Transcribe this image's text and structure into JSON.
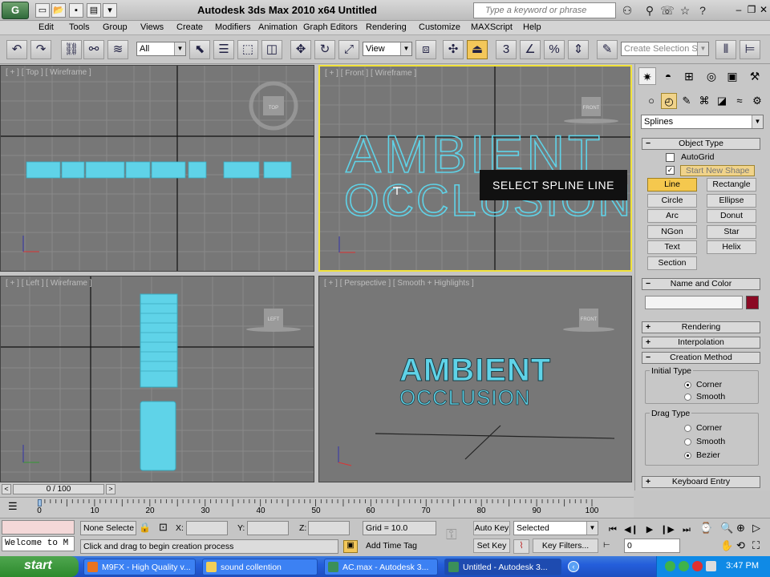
{
  "app": {
    "title": "Autodesk 3ds Max  2010 x64      Untitled",
    "logo": "G",
    "search_placeholder": "Type a keyword or phrase"
  },
  "menu": [
    "Edit",
    "Tools",
    "Group",
    "Views",
    "Create",
    "Modifiers",
    "Animation",
    "Graph Editors",
    "Rendering",
    "Customize",
    "MAXScript",
    "Help"
  ],
  "toolbar": {
    "selection_filter": "All",
    "ref_coord": "View",
    "named_selection_placeholder": "Create Selection Se"
  },
  "viewports": [
    {
      "id": "top",
      "label": "[ + ] [ Top ] [ Wireframe ]",
      "cube": "TOP"
    },
    {
      "id": "front",
      "label": "[ + ] [ Front ] [ Wireframe ]",
      "cube": "FRONT"
    },
    {
      "id": "left",
      "label": "[ + ] [ Left ] [ Wireframe ]",
      "cube": "LEFT"
    },
    {
      "id": "perspective",
      "label": "[ + ] [ Perspective ] [ Smooth + Highlights ]",
      "cube": "FRONT"
    }
  ],
  "text_objects": {
    "line1": "AMBIENT",
    "line2": "OCCLUSION"
  },
  "tooltip": "SELECT  SPLINE LINE",
  "command_panel": {
    "category": "Splines",
    "object_type": {
      "header": "Object Type",
      "autogrid_label": "AutoGrid",
      "start_new_shape_label": "Start New Shape",
      "buttons": [
        "Line",
        "Rectangle",
        "Circle",
        "Ellipse",
        "Arc",
        "Donut",
        "NGon",
        "Star",
        "Text",
        "Helix",
        "Section"
      ],
      "active": "Line"
    },
    "name_and_color": {
      "header": "Name and Color",
      "name_value": "",
      "color": "#8b0a24"
    },
    "rendering_header": "Rendering",
    "interpolation_header": "Interpolation",
    "creation_method": {
      "header": "Creation Method",
      "initial_type": {
        "title": "Initial Type",
        "options": [
          "Corner",
          "Smooth"
        ],
        "selected": "Corner"
      },
      "drag_type": {
        "title": "Drag Type",
        "options": [
          "Corner",
          "Smooth",
          "Bezier"
        ],
        "selected": "Bezier"
      }
    },
    "keyboard_entry_header": "Keyboard Entry"
  },
  "timeline": {
    "frame_display": "0 / 100",
    "ticks": [
      "0",
      "10",
      "20",
      "30",
      "40",
      "50",
      "60",
      "70",
      "80",
      "90",
      "100"
    ]
  },
  "status": {
    "maxscript_listener": "Welcome to M",
    "selection_status": "None Selecte",
    "x_label": "X:",
    "y_label": "Y:",
    "z_label": "Z:",
    "x_value": "",
    "y_value": "",
    "z_value": "",
    "grid": "Grid = 10.0",
    "prompt": "Click and drag to begin creation process",
    "add_time_tag": "Add Time Tag",
    "auto_key": "Auto Key",
    "set_key": "Set Key",
    "key_mode": "Selected",
    "key_filters": "Key Filters...",
    "current_frame": "0"
  },
  "taskbar": {
    "start": "start",
    "items": [
      {
        "label": "M9FX - High Quality v...",
        "icon_color": "#e8731f"
      },
      {
        "label": "sound collention",
        "icon_color": "#f2cf58"
      },
      {
        "label": "AC.max - Autodesk 3...",
        "icon_color": "#3b8f5a"
      },
      {
        "label": "Untitled - Autodesk 3...",
        "icon_color": "#3b8f5a"
      }
    ],
    "clock": "3:47 PM"
  },
  "colors": {
    "object_cyan": "#5fd3e8",
    "highlight_yellow": "#f5c84e",
    "viewport_gray": "#777777"
  }
}
